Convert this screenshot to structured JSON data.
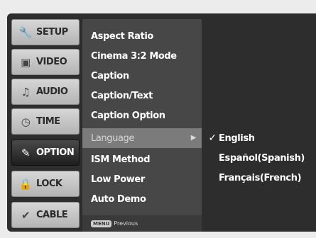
{
  "sidebar": {
    "items": [
      {
        "label": "SETUP",
        "icon": "wrench-icon"
      },
      {
        "label": "VIDEO",
        "icon": "monitor-icon"
      },
      {
        "label": "AUDIO",
        "icon": "speaker-icon"
      },
      {
        "label": "TIME",
        "icon": "clock-icon"
      },
      {
        "label": "OPTION",
        "icon": "tool-icon"
      },
      {
        "label": "LOCK",
        "icon": "lock-icon"
      },
      {
        "label": "CABLE",
        "icon": "cable-icon"
      }
    ],
    "active": "OPTION"
  },
  "menu": {
    "items": [
      "Aspect Ratio",
      "Cinema 3:2 Mode",
      "Caption",
      "Caption/Text",
      "Caption Option",
      "Language",
      "ISM Method",
      "Low Power",
      "Auto Demo"
    ],
    "selected": "Language",
    "footer_button": "MENU",
    "footer_text": "Previous"
  },
  "submenu": {
    "items": [
      {
        "label": "English",
        "checked": true
      },
      {
        "label": "Español(Spanish)",
        "checked": false
      },
      {
        "label": "Français(French)",
        "checked": false
      }
    ]
  },
  "colors": {
    "panel": "#2d2d2d",
    "menu": "#474747",
    "selected": "#7b7b7b",
    "side_active": "#1e1e1e"
  }
}
